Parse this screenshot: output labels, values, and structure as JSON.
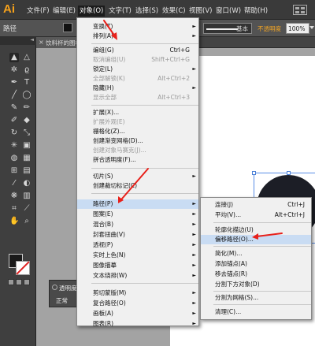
{
  "app": {
    "logo": "Ai"
  },
  "menubar": {
    "items": [
      {
        "label": "文件(F)"
      },
      {
        "label": "编辑(E)"
      },
      {
        "label": "对象(O)"
      },
      {
        "label": "文字(T)"
      },
      {
        "label": "选择(S)"
      },
      {
        "label": "效果(C)"
      },
      {
        "label": "视图(V)"
      },
      {
        "label": "窗口(W)"
      },
      {
        "label": "帮助(H)"
      }
    ]
  },
  "controlbar": {
    "path_label": "路径",
    "stroke_style": "基本",
    "opacity_label": "不透明度",
    "opacity_value": "100%"
  },
  "document_tab": {
    "close": "×",
    "title": "饮料杯的图标"
  },
  "object_menu": {
    "items": [
      {
        "label": "变换(T)",
        "shortcut": "",
        "submenu": true,
        "disabled": false
      },
      {
        "label": "排列(A)",
        "shortcut": "",
        "submenu": true,
        "disabled": false
      },
      {
        "label": "编组(G)",
        "shortcut": "Ctrl+G",
        "submenu": false,
        "disabled": false
      },
      {
        "label": "取消编组(U)",
        "shortcut": "Shift+Ctrl+G",
        "submenu": false,
        "disabled": true
      },
      {
        "label": "锁定(L)",
        "shortcut": "",
        "submenu": true,
        "disabled": false
      },
      {
        "label": "全部解锁(K)",
        "shortcut": "Alt+Ctrl+2",
        "submenu": false,
        "disabled": true
      },
      {
        "label": "隐藏(H)",
        "shortcut": "",
        "submenu": true,
        "disabled": false
      },
      {
        "label": "显示全部",
        "shortcut": "Alt+Ctrl+3",
        "submenu": false,
        "disabled": true
      },
      {
        "label": "扩展(X)...",
        "shortcut": "",
        "submenu": false,
        "disabled": false
      },
      {
        "label": "扩展外观(E)",
        "shortcut": "",
        "submenu": false,
        "disabled": true
      },
      {
        "label": "栅格化(Z)...",
        "shortcut": "",
        "submenu": false,
        "disabled": false
      },
      {
        "label": "创建渐变网格(D)...",
        "shortcut": "",
        "submenu": false,
        "disabled": false
      },
      {
        "label": "创建对象马赛克(J)...",
        "shortcut": "",
        "submenu": false,
        "disabled": true
      },
      {
        "label": "拼合透明度(F)...",
        "shortcut": "",
        "submenu": false,
        "disabled": false
      },
      {
        "label": "切片(S)",
        "shortcut": "",
        "submenu": true,
        "disabled": false
      },
      {
        "label": "创建裁切标记(C)",
        "shortcut": "",
        "submenu": false,
        "disabled": false
      },
      {
        "label": "路径(P)",
        "shortcut": "",
        "submenu": true,
        "disabled": false
      },
      {
        "label": "图案(E)",
        "shortcut": "",
        "submenu": true,
        "disabled": false
      },
      {
        "label": "混合(B)",
        "shortcut": "",
        "submenu": true,
        "disabled": false
      },
      {
        "label": "封套扭曲(V)",
        "shortcut": "",
        "submenu": true,
        "disabled": false
      },
      {
        "label": "透视(P)",
        "shortcut": "",
        "submenu": true,
        "disabled": false
      },
      {
        "label": "实时上色(N)",
        "shortcut": "",
        "submenu": true,
        "disabled": false
      },
      {
        "label": "图像描摹",
        "shortcut": "",
        "submenu": true,
        "disabled": false
      },
      {
        "label": "文本绕排(W)",
        "shortcut": "",
        "submenu": true,
        "disabled": false
      },
      {
        "label": "剪切蒙版(M)",
        "shortcut": "",
        "submenu": true,
        "disabled": false
      },
      {
        "label": "复合路径(O)",
        "shortcut": "",
        "submenu": true,
        "disabled": false
      },
      {
        "label": "画板(A)",
        "shortcut": "",
        "submenu": true,
        "disabled": false
      },
      {
        "label": "图表(R)",
        "shortcut": "",
        "submenu": true,
        "disabled": false
      }
    ]
  },
  "path_submenu": {
    "items": [
      {
        "label": "连接(J)",
        "shortcut": "Ctrl+J"
      },
      {
        "label": "平均(V)...",
        "shortcut": "Alt+Ctrl+J"
      },
      {
        "label": "轮廓化描边(U)",
        "shortcut": ""
      },
      {
        "label": "偏移路径(O)...",
        "shortcut": ""
      },
      {
        "label": "简化(M)...",
        "shortcut": ""
      },
      {
        "label": "添加锚点(A)",
        "shortcut": ""
      },
      {
        "label": "移去锚点(R)",
        "shortcut": ""
      },
      {
        "label": "分割下方对象(D)",
        "shortcut": ""
      },
      {
        "label": "分割为网格(S)...",
        "shortcut": ""
      },
      {
        "label": "清理(C)...",
        "shortcut": ""
      }
    ]
  },
  "panels": {
    "transparency": {
      "title": "透明度",
      "mode": "正常"
    }
  },
  "colors": {
    "accent_arrow": "#e8201a",
    "highlight": "#c9dcf3",
    "menubar": "#3a3a3a"
  }
}
